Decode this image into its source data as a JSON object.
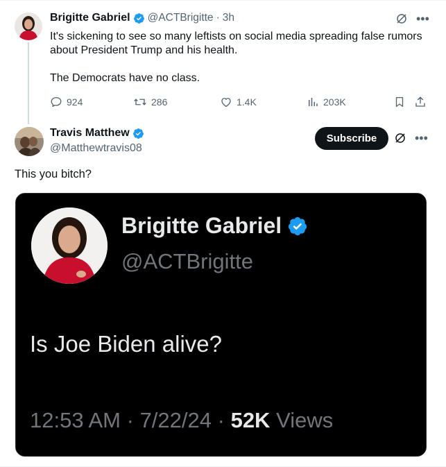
{
  "colors": {
    "verified_blue": "#1d9bf0",
    "text_primary": "#0f1419",
    "text_secondary": "#536471",
    "button_dark": "#0f1419"
  },
  "parent_tweet": {
    "author_name": "Brigitte Gabriel",
    "handle": "@ACTBrigitte",
    "separator": "·",
    "time": "3h",
    "text_line1": "It's sickening to see so many leftists on social media spreading false rumors about President Trump and his health.",
    "text_line2": "The Democrats have no class.",
    "replies": "924",
    "retweets": "286",
    "likes": "1.4K",
    "views": "203K",
    "icons": {
      "grok": "grok-icon",
      "more": "more-icon",
      "reply": "reply-icon",
      "retweet": "retweet-icon",
      "like": "heart-icon",
      "views": "views-icon",
      "bookmark": "bookmark-icon",
      "share": "share-icon"
    }
  },
  "reply_tweet": {
    "author_name": "Travis Matthew",
    "handle": "@Matthewtravis08",
    "subscribe_label": "Subscribe",
    "text": "This you bitch?"
  },
  "embedded_image": {
    "author_name": "Brigitte Gabriel",
    "handle": "@ACTBrigitte",
    "text": "Is Joe Biden alive?",
    "time": "12:53 AM",
    "date": "7/22/24",
    "views_count": "52K",
    "views_label": "Views",
    "separator": "·"
  }
}
